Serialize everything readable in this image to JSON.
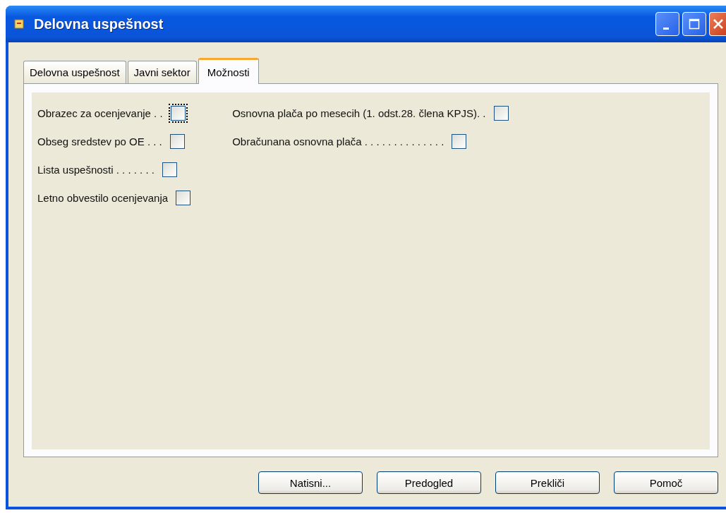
{
  "window": {
    "title": "Delovna uspešnost"
  },
  "tabs": [
    {
      "label": "Delovna uspešnost",
      "selected": false
    },
    {
      "label": "Javni sektor",
      "selected": false
    },
    {
      "label": "Možnosti",
      "selected": true
    }
  ],
  "options": [
    [
      {
        "label": "Obrazec za ocenjevanje . .",
        "checked": false,
        "focused": true
      },
      {
        "label": "Obseg sredstev po OE . . .",
        "checked": false,
        "focused": false
      },
      {
        "label": "Lista uspešnosti . . . . . . .",
        "checked": false,
        "focused": false
      },
      {
        "label": "Letno obvestilo ocenjevanja",
        "checked": false,
        "focused": false
      }
    ],
    [
      {
        "label": "Osnovna plača po mesecih (1. odst.28. člena KPJS). .",
        "checked": false,
        "focused": false
      },
      {
        "label": "Obračunana osnovna plača . . . . . . . . . . . . . .",
        "checked": false,
        "focused": false
      }
    ]
  ],
  "buttons": [
    "Natisni...",
    "Predogled",
    "Prekliči",
    "Pomoč"
  ]
}
